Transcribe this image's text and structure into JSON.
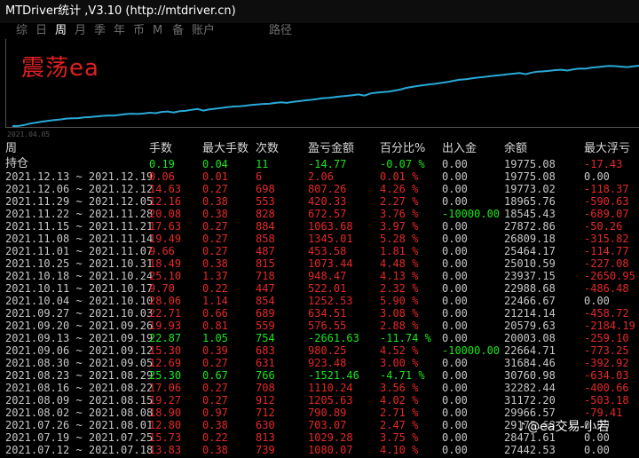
{
  "window": {
    "title": "MTDriver统计 ,V3.10 (http://mtdriver.cn)"
  },
  "menu": {
    "items": [
      {
        "label": "综",
        "active": false
      },
      {
        "label": "日",
        "active": false
      },
      {
        "label": "周",
        "active": true
      },
      {
        "label": "月",
        "active": false
      },
      {
        "label": "季",
        "active": false
      },
      {
        "label": "年",
        "active": false
      },
      {
        "label": "币",
        "active": false
      },
      {
        "label": "M",
        "active": false
      },
      {
        "label": "备",
        "active": false
      },
      {
        "label": "账户",
        "active": false
      },
      {
        "label": "路径",
        "active": false
      }
    ]
  },
  "chart_data": {
    "type": "line",
    "title": "震荡ea",
    "x_start_label": "2021.04.05",
    "line_color": "#2aa9d8",
    "series": [
      {
        "values": [
          19500,
          19530,
          19760,
          20120,
          20360,
          20600,
          20800,
          20990,
          21130,
          21330,
          21420,
          21450,
          21640,
          21710,
          21860,
          21990,
          22110,
          22080,
          22250,
          22450,
          22540,
          22470,
          22580,
          22790,
          22670,
          22980,
          23090,
          22860,
          23170,
          23240,
          23520,
          23700,
          23320,
          23590,
          23780,
          23960,
          24140,
          24310,
          24390,
          24520,
          24700,
          24830,
          24960,
          25010,
          25200,
          25370,
          25210,
          25480,
          25630,
          25830,
          25970,
          26170,
          26380,
          26460,
          26640,
          26820,
          26960,
          27130,
          27290,
          27020,
          27550,
          27730,
          27870,
          28010,
          28240,
          28510,
          28920,
          29160,
          29400,
          29600,
          29800,
          29950,
          30180,
          30390,
          30700,
          30940,
          31080,
          31280,
          31460,
          31610,
          31790,
          31970,
          32100,
          32300,
          32420,
          32580,
          32300,
          32700,
          32900,
          33000,
          33150,
          33300,
          33400,
          33200,
          33500,
          33700,
          33650,
          33900,
          34050,
          34200,
          34350,
          34300,
          34150,
          34050,
          34250,
          34400
        ]
      }
    ]
  },
  "table": {
    "headers": [
      "周",
      "手数",
      "最大手数",
      "次数",
      "盈亏金额",
      "百分比%",
      "出入金",
      "余额",
      "最大浮亏"
    ],
    "rows": [
      {
        "period": "持仓",
        "lots": "0.19",
        "max_lots": "0.04",
        "count": "11",
        "pnl": "-14.77",
        "pct": "-0.07 %",
        "io": "0.00",
        "balance": "19775.08",
        "max_dd": "-17.43",
        "color": "#19e619"
      },
      {
        "period": "2021.12.13 ~ 2021.12.19",
        "lots": "0.06",
        "max_lots": "0.01",
        "count": "6",
        "pnl": "2.06",
        "pct": "0.01 %",
        "io": "0.00",
        "balance": "19775.08",
        "max_dd": "0.00",
        "color": "#e62828"
      },
      {
        "period": "2021.12.06 ~ 2021.12.12",
        "lots": "14.63",
        "max_lots": "0.27",
        "count": "698",
        "pnl": "807.26",
        "pct": "4.26 %",
        "io": "0.00",
        "balance": "19773.02",
        "max_dd": "-118.37",
        "color": "#e62828"
      },
      {
        "period": "2021.11.29 ~ 2021.12.05",
        "lots": "12.16",
        "max_lots": "0.38",
        "count": "553",
        "pnl": "420.33",
        "pct": "2.27 %",
        "io": "0.00",
        "balance": "18965.76",
        "max_dd": "-590.63",
        "color": "#e62828"
      },
      {
        "period": "2021.11.22 ~ 2021.11.28",
        "lots": "20.08",
        "max_lots": "0.38",
        "count": "828",
        "pnl": "672.57",
        "pct": "3.76 %",
        "io": "-10000.00",
        "balance": "18545.43",
        "max_dd": "-689.07",
        "color": "#e62828"
      },
      {
        "period": "2021.11.15 ~ 2021.11.21",
        "lots": "17.63",
        "max_lots": "0.27",
        "count": "884",
        "pnl": "1063.68",
        "pct": "3.97 %",
        "io": "0.00",
        "balance": "27872.86",
        "max_dd": "-50.26",
        "color": "#e62828"
      },
      {
        "period": "2021.11.08 ~ 2021.11.14",
        "lots": "19.49",
        "max_lots": "0.27",
        "count": "858",
        "pnl": "1345.01",
        "pct": "5.28 %",
        "io": "0.00",
        "balance": "26809.18",
        "max_dd": "-315.82",
        "color": "#e62828"
      },
      {
        "period": "2021.11.01 ~ 2021.11.07",
        "lots": "9.66",
        "max_lots": "0.27",
        "count": "487",
        "pnl": "453.58",
        "pct": "1.81 %",
        "io": "0.00",
        "balance": "25464.17",
        "max_dd": "-114.77",
        "color": "#e62828"
      },
      {
        "period": "2021.10.25 ~ 2021.10.31",
        "lots": "18.49",
        "max_lots": "0.38",
        "count": "815",
        "pnl": "1073.44",
        "pct": "4.48 %",
        "io": "0.00",
        "balance": "25010.59",
        "max_dd": "-227.08",
        "color": "#e62828"
      },
      {
        "period": "2021.10.18 ~ 2021.10.24",
        "lots": "25.10",
        "max_lots": "1.37",
        "count": "718",
        "pnl": "948.47",
        "pct": "4.13 %",
        "io": "0.00",
        "balance": "23937.15",
        "max_dd": "-2650.95",
        "color": "#e62828"
      },
      {
        "period": "2021.10.11 ~ 2021.10.17",
        "lots": "9.70",
        "max_lots": "0.22",
        "count": "447",
        "pnl": "522.01",
        "pct": "2.32 %",
        "io": "0.00",
        "balance": "22988.68",
        "max_dd": "-486.48",
        "color": "#e62828"
      },
      {
        "period": "2021.10.04 ~ 2021.10.10",
        "lots": "28.06",
        "max_lots": "1.14",
        "count": "854",
        "pnl": "1252.53",
        "pct": "5.90 %",
        "io": "0.00",
        "balance": "22466.67",
        "max_dd": "0.00",
        "color": "#e62828"
      },
      {
        "period": "2021.09.27 ~ 2021.10.03",
        "lots": "22.71",
        "max_lots": "0.66",
        "count": "689",
        "pnl": "634.51",
        "pct": "3.08 %",
        "io": "0.00",
        "balance": "21214.14",
        "max_dd": "-458.72",
        "color": "#e62828"
      },
      {
        "period": "2021.09.20 ~ 2021.09.26",
        "lots": "19.93",
        "max_lots": "0.81",
        "count": "559",
        "pnl": "576.55",
        "pct": "2.88 %",
        "io": "0.00",
        "balance": "20579.63",
        "max_dd": "-2184.19",
        "color": "#e62828"
      },
      {
        "period": "2021.09.13 ~ 2021.09.19",
        "lots": "22.87",
        "max_lots": "1.05",
        "count": "754",
        "pnl": "-2661.63",
        "pct": "-11.74 %",
        "io": "0.00",
        "balance": "20003.08",
        "max_dd": "-259.10",
        "color": "#19e619"
      },
      {
        "period": "2021.09.06 ~ 2021.09.12",
        "lots": "15.30",
        "max_lots": "0.39",
        "count": "683",
        "pnl": "980.25",
        "pct": "4.52 %",
        "io": "-10000.00",
        "balance": "22664.71",
        "max_dd": "-773.25",
        "color": "#e62828"
      },
      {
        "period": "2021.08.30 ~ 2021.09.05",
        "lots": "12.69",
        "max_lots": "0.27",
        "count": "631",
        "pnl": "923.48",
        "pct": "3.00 %",
        "io": "0.00",
        "balance": "31684.46",
        "max_dd": "-392.92",
        "color": "#e62828"
      },
      {
        "period": "2021.08.23 ~ 2021.08.29",
        "lots": "25.30",
        "max_lots": "0.67",
        "count": "766",
        "pnl": "-1521.46",
        "pct": "-4.71 %",
        "io": "0.00",
        "balance": "30760.98",
        "max_dd": "-634.03",
        "color": "#19e619"
      },
      {
        "period": "2021.08.16 ~ 2021.08.22",
        "lots": "17.06",
        "max_lots": "0.27",
        "count": "708",
        "pnl": "1110.24",
        "pct": "3.56 %",
        "io": "0.00",
        "balance": "32282.44",
        "max_dd": "-400.66",
        "color": "#e62828"
      },
      {
        "period": "2021.08.09 ~ 2021.08.15",
        "lots": "19.27",
        "max_lots": "0.27",
        "count": "912",
        "pnl": "1205.63",
        "pct": "4.02 %",
        "io": "0.00",
        "balance": "31172.20",
        "max_dd": "-503.18",
        "color": "#e62828"
      },
      {
        "period": "2021.08.02 ~ 2021.08.08",
        "lots": "18.90",
        "max_lots": "0.97",
        "count": "712",
        "pnl": "790.89",
        "pct": "2.71 %",
        "io": "0.00",
        "balance": "29966.57",
        "max_dd": "-79.41",
        "color": "#e62828"
      },
      {
        "period": "2021.07.26 ~ 2021.08.01",
        "lots": "12.80",
        "max_lots": "0.38",
        "count": "630",
        "pnl": "703.07",
        "pct": "2.47 %",
        "io": "0.00",
        "balance": "29175.68",
        "max_dd": "0.00",
        "color": "#e62828"
      },
      {
        "period": "2021.07.19 ~ 2021.07.25",
        "lots": "15.73",
        "max_lots": "0.22",
        "count": "813",
        "pnl": "1029.28",
        "pct": "3.75 %",
        "io": "0.00",
        "balance": "28471.61",
        "max_dd": "0.00",
        "color": "#e62828"
      },
      {
        "period": "2021.07.12 ~ 2021.07.18",
        "lots": "13.83",
        "max_lots": "0.38",
        "count": "739",
        "pnl": "1080.07",
        "pct": "4.10 %",
        "io": "0.00",
        "balance": "27442.53",
        "max_dd": "0.00",
        "color": "#e62828"
      }
    ]
  },
  "watermark": {
    "text": "@ea交易-小若",
    "icon": "douyin-note-icon"
  },
  "colors": {
    "profit": "#e62828",
    "loss": "#19e619",
    "neutral": "#c8c8c8",
    "line": "#2aa9d8",
    "title_red": "#e02020"
  }
}
